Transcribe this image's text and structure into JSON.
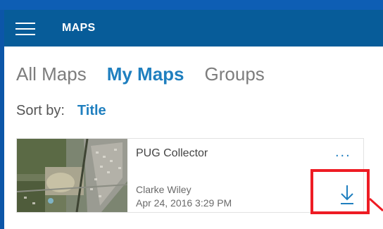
{
  "app": {
    "title": "MAPS",
    "accent_color": "#075c99",
    "link_color": "#1f7fbf"
  },
  "icons": {
    "menu": "hamburger-icon",
    "more": "ellipsis-icon",
    "download": "download-icon"
  },
  "tabs": [
    {
      "label": "All Maps",
      "active": false
    },
    {
      "label": "My Maps",
      "active": true
    },
    {
      "label": "Groups",
      "active": false
    }
  ],
  "sort": {
    "label": "Sort by:",
    "value": "Title"
  },
  "map_card": {
    "title": "PUG Collector",
    "more_label": "...",
    "owner": "Clarke Wiley",
    "date": "Apr 24, 2016 3:29 PM"
  },
  "annotation": {
    "highlight_color": "#ee1c24"
  }
}
